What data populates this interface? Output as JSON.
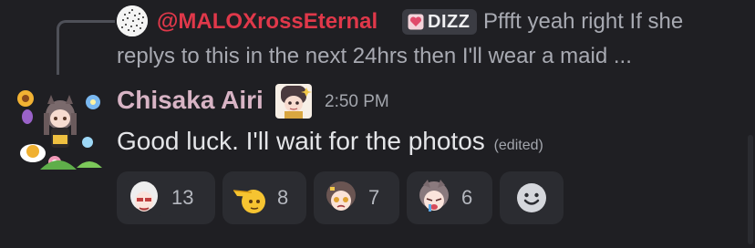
{
  "reply": {
    "author": "@MALOXrossEternal",
    "tag": "DIZZ",
    "text_line1": "Pffft yeah right  If she",
    "text_line2": "replys to this in the next 24hrs then I'll wear a maid ...",
    "author_color": "#e0384a"
  },
  "message": {
    "author": "Chisaka Airi",
    "timestamp": "2:50 PM",
    "text": "Good luck. I'll wait for the photos",
    "edited_label": "(edited)",
    "author_color": "#d8b4c5"
  },
  "reactions": [
    {
      "emoji": "white-haired-girl-emoji",
      "count": "13"
    },
    {
      "emoji": "saluting-face-emoji",
      "count": "8"
    },
    {
      "emoji": "crying-girl-emoji",
      "count": "7"
    },
    {
      "emoji": "silver-hair-girl-emoji",
      "count": "6"
    }
  ],
  "add_reaction": {
    "icon": "smiley-icon"
  }
}
